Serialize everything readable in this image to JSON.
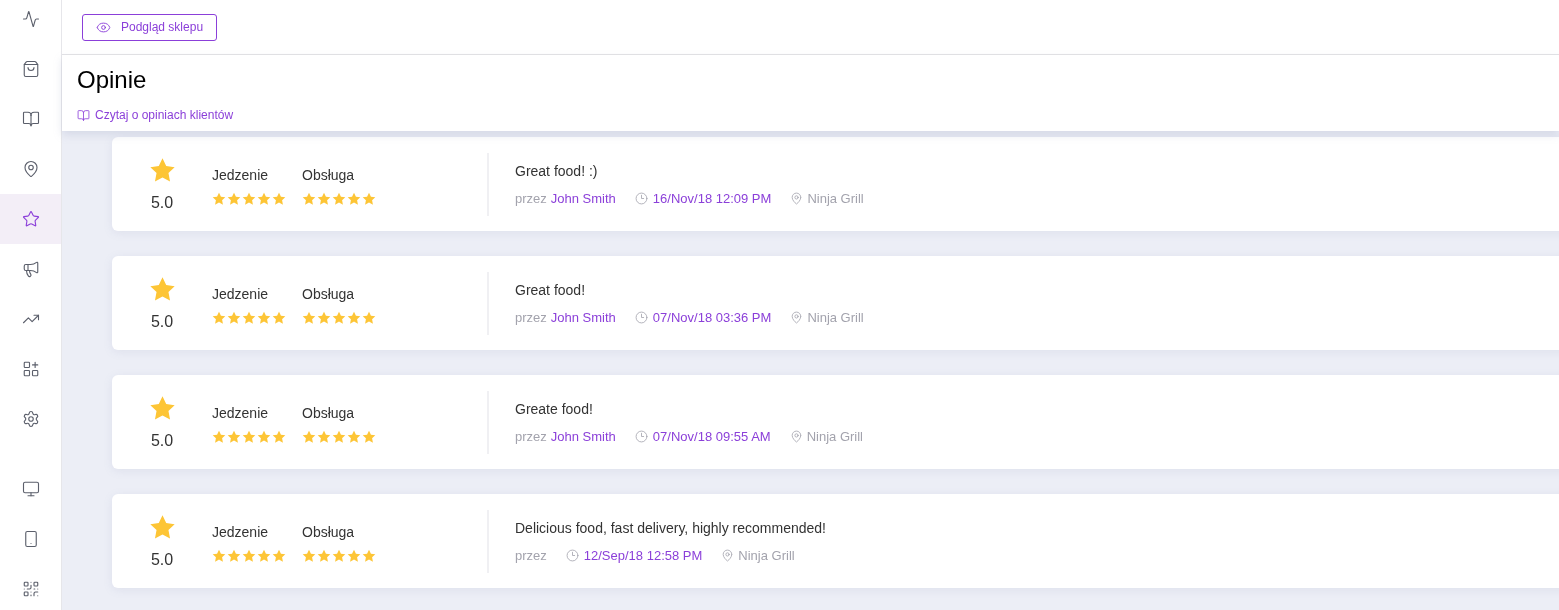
{
  "sidebar": {
    "main_items": [
      {
        "selected": false
      },
      {
        "selected": false
      },
      {
        "selected": false
      },
      {
        "selected": false
      },
      {
        "selected": true
      },
      {
        "selected": false
      },
      {
        "selected": false
      },
      {
        "selected": false
      },
      {
        "selected": false
      }
    ],
    "bottom_items": [
      {
        "selected": false
      },
      {
        "selected": false
      },
      {
        "selected": false
      }
    ]
  },
  "toolbar": {
    "preview_button": "Podgląd sklepu"
  },
  "header": {
    "title": "Opinie",
    "help_link": "Czytaj o opiniach klientów"
  },
  "reviews": [
    {
      "rating": "5.0",
      "categories": [
        {
          "label": "Jedzenie",
          "stars": 5
        },
        {
          "label": "Obsługa",
          "stars": 5
        }
      ],
      "comment": "Great food! :)",
      "author_prefix": "przez",
      "author": "John Smith",
      "date": "16/Nov/18 12:09 PM",
      "location": "Ninja Grill"
    },
    {
      "rating": "5.0",
      "categories": [
        {
          "label": "Jedzenie",
          "stars": 5
        },
        {
          "label": "Obsługa",
          "stars": 5
        }
      ],
      "comment": "Great food!",
      "author_prefix": "przez",
      "author": "John Smith",
      "date": "07/Nov/18 03:36 PM",
      "location": "Ninja Grill"
    },
    {
      "rating": "5.0",
      "categories": [
        {
          "label": "Jedzenie",
          "stars": 5
        },
        {
          "label": "Obsługa",
          "stars": 5
        }
      ],
      "comment": "Greate food!",
      "author_prefix": "przez",
      "author": "John Smith",
      "date": "07/Nov/18 09:55 AM",
      "location": "Ninja Grill"
    },
    {
      "rating": "5.0",
      "categories": [
        {
          "label": "Jedzenie",
          "stars": 5
        },
        {
          "label": "Obsługa",
          "stars": 5
        }
      ],
      "comment": "Delicious food, fast delivery, highly recommended!",
      "author_prefix": "przez",
      "date": "12/Sep/18 12:58 PM",
      "location": "Ninja Grill"
    }
  ]
}
